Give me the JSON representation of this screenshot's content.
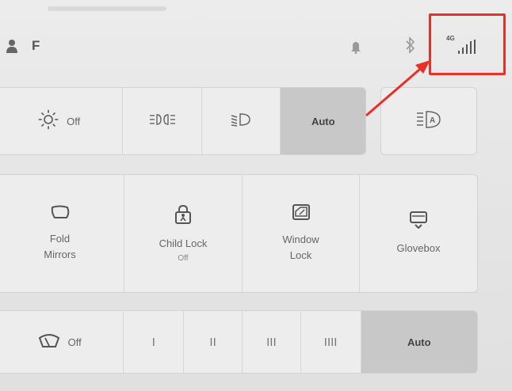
{
  "status_bar": {
    "profile_name": "F",
    "signal_label": "4G",
    "icons": [
      "person-icon",
      "bell-icon",
      "bluetooth-icon",
      "signal-icon"
    ]
  },
  "lights": {
    "items": [
      {
        "icon": "sun-icon",
        "label": "Off"
      },
      {
        "icon": "parking-lights-icon",
        "label": ""
      },
      {
        "icon": "low-beam-icon",
        "label": ""
      },
      {
        "icon": "",
        "label": "Auto",
        "active": true
      }
    ],
    "auto_high_beam_icon": "auto-high-beam-icon"
  },
  "controls": {
    "items": [
      {
        "icon": "mirror-icon",
        "label_line1": "Fold",
        "label_line2": "Mirrors",
        "sub": ""
      },
      {
        "icon": "child-lock-icon",
        "label_line1": "Child Lock",
        "label_line2": "",
        "sub": "Off"
      },
      {
        "icon": "window-lock-icon",
        "label_line1": "Window",
        "label_line2": "Lock",
        "sub": ""
      },
      {
        "icon": "glovebox-icon",
        "label_line1": "Glovebox",
        "label_line2": "",
        "sub": ""
      }
    ]
  },
  "wipers": {
    "off_label": "Off",
    "speeds": [
      "I",
      "II",
      "III",
      "IIII"
    ],
    "auto_label": "Auto",
    "active": "Auto"
  },
  "annotation": {
    "color": "#e8302a"
  }
}
